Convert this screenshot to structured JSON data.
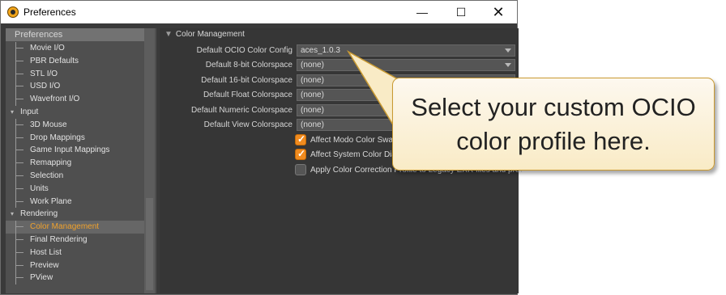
{
  "window": {
    "title": "Preferences",
    "minimize_symbol": "—",
    "maximize_symbol": "☐",
    "close_symbol": "✕"
  },
  "sidebar": {
    "header": "Preferences",
    "items": [
      {
        "label": "Movie I/O",
        "type": "child"
      },
      {
        "label": "PBR Defaults",
        "type": "child"
      },
      {
        "label": "STL I/O",
        "type": "child"
      },
      {
        "label": "USD I/O",
        "type": "child"
      },
      {
        "label": "Wavefront I/O",
        "type": "child"
      },
      {
        "label": "Input",
        "type": "group"
      },
      {
        "label": "3D Mouse",
        "type": "child"
      },
      {
        "label": "Drop Mappings",
        "type": "child"
      },
      {
        "label": "Game Input Mappings",
        "type": "child"
      },
      {
        "label": "Remapping",
        "type": "child"
      },
      {
        "label": "Selection",
        "type": "child"
      },
      {
        "label": "Units",
        "type": "child"
      },
      {
        "label": "Work Plane",
        "type": "child"
      },
      {
        "label": "Rendering",
        "type": "group"
      },
      {
        "label": "Color Management",
        "type": "child",
        "selected": true
      },
      {
        "label": "Final Rendering",
        "type": "child"
      },
      {
        "label": "Host List",
        "type": "child"
      },
      {
        "label": "Preview",
        "type": "child"
      },
      {
        "label": "PView",
        "type": "child"
      }
    ]
  },
  "content": {
    "section": {
      "arrow": "▼",
      "title": "Color Management"
    },
    "settings": [
      {
        "label": "Default OCIO Color Config",
        "value": "aces_1.0.3",
        "dropdown": true
      },
      {
        "label": "Default 8-bit Colorspace",
        "value": "(none)",
        "dropdown": true
      },
      {
        "label": "Default 16-bit Colorspace",
        "value": "(none)",
        "dropdown": false
      },
      {
        "label": "Default Float Colorspace",
        "value": "(none)",
        "dropdown": false
      },
      {
        "label": "Default Numeric Colorspace",
        "value": "(none)",
        "dropdown": false
      },
      {
        "label": "Default View Colorspace",
        "value": "(none)",
        "dropdown": false
      }
    ],
    "checkboxes": [
      {
        "label": "Affect Modo Color Swatches",
        "checked": true
      },
      {
        "label": "Affect System Color Dialogs",
        "checked": true
      },
      {
        "label": "Apply Color Correction Profile to Legacy EXR files and previews",
        "checked": false
      }
    ]
  },
  "callout": {
    "text": "Select your custom OCIO color profile here."
  },
  "colors": {
    "accent": "#f1a22c",
    "callout_border": "#c99a32"
  }
}
